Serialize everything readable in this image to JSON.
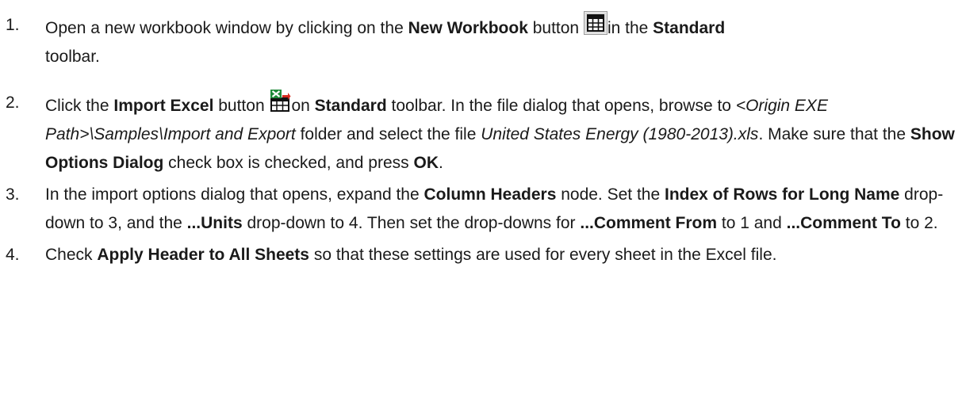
{
  "steps": [
    {
      "num": "1.",
      "segments": [
        {
          "text": "Open a new workbook window by clicking on the ",
          "style": "normal"
        },
        {
          "text": "New Workbook",
          "style": "bold"
        },
        {
          "text": " button ",
          "style": "normal"
        },
        {
          "icon": "new-workbook-icon"
        },
        {
          "text": "in the ",
          "style": "normal"
        },
        {
          "text": "Standard",
          "style": "bold"
        },
        {
          "text": " toolbar.",
          "style": "normal"
        }
      ]
    },
    {
      "num": "2.",
      "segments": [
        {
          "text": "Click the ",
          "style": "normal"
        },
        {
          "text": "Import Excel",
          "style": "bold"
        },
        {
          "text": " button ",
          "style": "normal"
        },
        {
          "icon": "import-excel-icon"
        },
        {
          "text": "on ",
          "style": "normal"
        },
        {
          "text": "Standard",
          "style": "bold"
        },
        {
          "text": " toolbar. In the file dialog that opens, browse to ",
          "style": "normal"
        },
        {
          "text": "<Origin EXE Path>\\Samples\\Import and Export",
          "style": "italic"
        },
        {
          "text": " folder and select the file ",
          "style": "normal"
        },
        {
          "text": "United States Energy (1980-2013).xls",
          "style": "italic"
        },
        {
          "text": ". Make sure that the ",
          "style": "normal"
        },
        {
          "text": "Show Options Dialog",
          "style": "bold"
        },
        {
          "text": " check box is checked, and press ",
          "style": "normal"
        },
        {
          "text": "OK",
          "style": "bold"
        },
        {
          "text": ".",
          "style": "normal"
        }
      ]
    },
    {
      "num": "3.",
      "segments": [
        {
          "text": "In the import options dialog that opens, expand the ",
          "style": "normal"
        },
        {
          "text": "Column Headers",
          "style": "bold"
        },
        {
          "text": " node. Set the ",
          "style": "normal"
        },
        {
          "text": "Index of Rows for Long Name",
          "style": "bold"
        },
        {
          "text": " drop-down to 3, and the ",
          "style": "normal"
        },
        {
          "text": "...Units",
          "style": "bold"
        },
        {
          "text": " drop-down to 4. Then set the drop-downs for ",
          "style": "normal"
        },
        {
          "text": "...Comment From",
          "style": "bold"
        },
        {
          "text": " to 1 and ",
          "style": "normal"
        },
        {
          "text": "...Comment To",
          "style": "bold"
        },
        {
          "text": " to 2.",
          "style": "normal"
        }
      ]
    },
    {
      "num": "4.",
      "segments": [
        {
          "text": "Check ",
          "style": "normal"
        },
        {
          "text": "Apply Header to All Sheets",
          "style": "bold"
        },
        {
          "text": " so that these settings are used for every sheet in the Excel file.",
          "style": "normal"
        }
      ]
    }
  ]
}
